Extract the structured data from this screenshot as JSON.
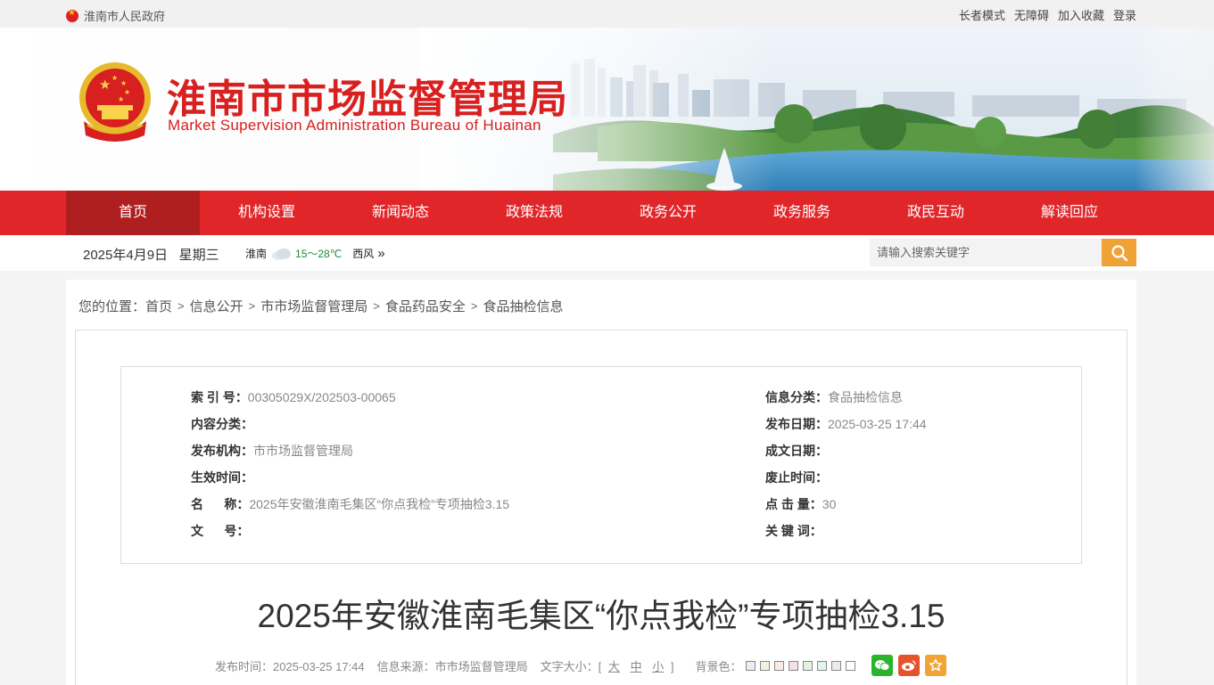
{
  "topbar": {
    "site_name": "淮南市人民政府",
    "links": [
      "长者模式",
      "无障碍",
      "加入收藏",
      "登录"
    ]
  },
  "header": {
    "title_cn": "淮南市市场监督管理局",
    "title_en": "Market Supervision Administration Bureau of Huainan"
  },
  "nav": {
    "items": [
      "首页",
      "机构设置",
      "新闻动态",
      "政策法规",
      "政务公开",
      "政务服务",
      "政民互动",
      "解读回应"
    ],
    "active_index": 0
  },
  "infobar": {
    "date": "2025年4月9日",
    "weekday": "星期三",
    "city": "淮南",
    "temp": "15～28℃",
    "wind": "西风",
    "wind_arrow": "»",
    "search_placeholder": "请输入搜索关键字"
  },
  "breadcrumb": {
    "prefix": "您的位置：",
    "items": [
      "首页",
      "信息公开",
      "市市场监督管理局",
      "食品药品安全",
      "食品抽检信息"
    ],
    "separator": ">"
  },
  "meta": {
    "left": [
      {
        "key": "索 引 号：",
        "value": "00305029X/202503-00065"
      },
      {
        "key": "内容分类：",
        "value": ""
      },
      {
        "key": "发布机构：",
        "value": "市市场监督管理局"
      },
      {
        "key": "生效时间：",
        "value": ""
      },
      {
        "key": "名      称：",
        "value": "2025年安徽淮南毛集区“你点我检”专项抽检3.15"
      },
      {
        "key": "文      号：",
        "value": ""
      }
    ],
    "right": [
      {
        "key": "信息分类：",
        "value": "食品抽检信息"
      },
      {
        "key": "发布日期：",
        "value": "2025-03-25 17:44"
      },
      {
        "key": "成文日期：",
        "value": ""
      },
      {
        "key": "废止时间：",
        "value": ""
      },
      {
        "key": "点 击 量：",
        "value": "30"
      },
      {
        "key": "关 键 词：",
        "value": ""
      }
    ]
  },
  "article": {
    "title": "2025年安徽淮南毛集区“你点我检”专项抽检3.15",
    "publish_time": "发布时间：2025-03-25 17:44",
    "source": "信息来源：市市场监督管理局",
    "font_size_label": "文字大小：[",
    "font_sizes": [
      "大",
      "中",
      "小"
    ],
    "font_size_close": "]",
    "bg_label": "背景色：",
    "bg_colors": [
      "#e9eef5",
      "#f2f2e4",
      "#f8ece4",
      "#f5e3e3",
      "#e4f2e0",
      "#e2f3f3",
      "#ececec",
      "#ffffff"
    ]
  },
  "colors": {
    "brand_red": "#e1262a",
    "nav_active": "#b01f1f",
    "search_orange": "#f0a236",
    "wechat": "#28b52d",
    "weibo": "#e5532d",
    "favorite": "#f3a332"
  }
}
